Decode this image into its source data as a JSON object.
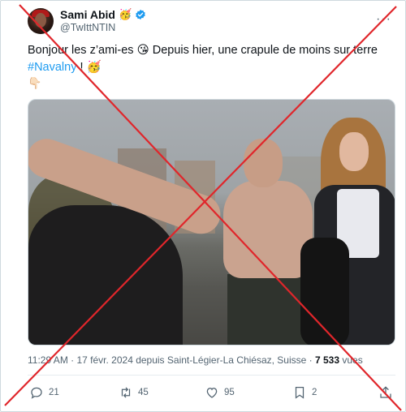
{
  "author": {
    "display_name": "Sami Abid",
    "name_emoji": "🥳",
    "handle": "@TwIttNTIN",
    "verified": true
  },
  "tweet": {
    "text_main": "Bonjour les z’ami-es 😘 Depuis hier, une crapule de moins sur terre",
    "hashtag": "#Navalny",
    "text_tail": " ! 🥳",
    "pointer_emoji": "👇🏻"
  },
  "meta": {
    "time_place": "11:29 AM · 17 févr. 2024 depuis Saint-Légier-La Chiésaz, Suisse · ",
    "views_count": "7 533",
    "views_label": " vues"
  },
  "actions": {
    "replies": "21",
    "reposts": "45",
    "likes": "95",
    "bookmarks": "2"
  },
  "icons": {
    "more": "more-icon",
    "verified": "verified-badge-icon",
    "reply": "reply-icon",
    "repost": "repost-icon",
    "like": "heart-icon",
    "bookmark": "bookmark-icon",
    "share": "share-icon"
  },
  "colors": {
    "hashtag": "#1d9bf0",
    "verified": "#1d9bf0",
    "cross": "#e0262b",
    "secondary_text": "#536471"
  }
}
